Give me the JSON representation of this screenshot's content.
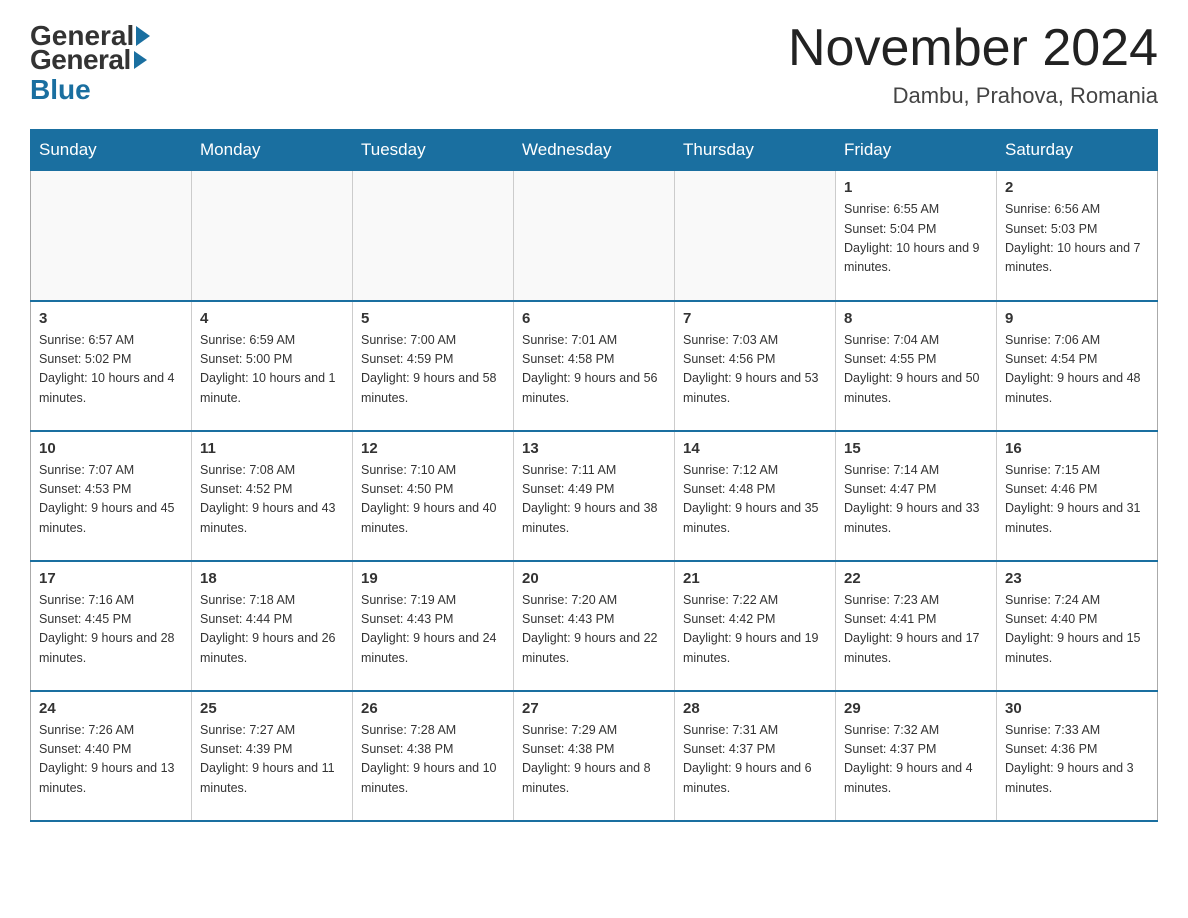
{
  "header": {
    "logo_general": "General",
    "logo_blue": "Blue",
    "title": "November 2024",
    "subtitle": "Dambu, Prahova, Romania"
  },
  "days_of_week": [
    "Sunday",
    "Monday",
    "Tuesday",
    "Wednesday",
    "Thursday",
    "Friday",
    "Saturday"
  ],
  "weeks": [
    [
      {
        "day": "",
        "info": ""
      },
      {
        "day": "",
        "info": ""
      },
      {
        "day": "",
        "info": ""
      },
      {
        "day": "",
        "info": ""
      },
      {
        "day": "",
        "info": ""
      },
      {
        "day": "1",
        "info": "Sunrise: 6:55 AM\nSunset: 5:04 PM\nDaylight: 10 hours and 9 minutes."
      },
      {
        "day": "2",
        "info": "Sunrise: 6:56 AM\nSunset: 5:03 PM\nDaylight: 10 hours and 7 minutes."
      }
    ],
    [
      {
        "day": "3",
        "info": "Sunrise: 6:57 AM\nSunset: 5:02 PM\nDaylight: 10 hours and 4 minutes."
      },
      {
        "day": "4",
        "info": "Sunrise: 6:59 AM\nSunset: 5:00 PM\nDaylight: 10 hours and 1 minute."
      },
      {
        "day": "5",
        "info": "Sunrise: 7:00 AM\nSunset: 4:59 PM\nDaylight: 9 hours and 58 minutes."
      },
      {
        "day": "6",
        "info": "Sunrise: 7:01 AM\nSunset: 4:58 PM\nDaylight: 9 hours and 56 minutes."
      },
      {
        "day": "7",
        "info": "Sunrise: 7:03 AM\nSunset: 4:56 PM\nDaylight: 9 hours and 53 minutes."
      },
      {
        "day": "8",
        "info": "Sunrise: 7:04 AM\nSunset: 4:55 PM\nDaylight: 9 hours and 50 minutes."
      },
      {
        "day": "9",
        "info": "Sunrise: 7:06 AM\nSunset: 4:54 PM\nDaylight: 9 hours and 48 minutes."
      }
    ],
    [
      {
        "day": "10",
        "info": "Sunrise: 7:07 AM\nSunset: 4:53 PM\nDaylight: 9 hours and 45 minutes."
      },
      {
        "day": "11",
        "info": "Sunrise: 7:08 AM\nSunset: 4:52 PM\nDaylight: 9 hours and 43 minutes."
      },
      {
        "day": "12",
        "info": "Sunrise: 7:10 AM\nSunset: 4:50 PM\nDaylight: 9 hours and 40 minutes."
      },
      {
        "day": "13",
        "info": "Sunrise: 7:11 AM\nSunset: 4:49 PM\nDaylight: 9 hours and 38 minutes."
      },
      {
        "day": "14",
        "info": "Sunrise: 7:12 AM\nSunset: 4:48 PM\nDaylight: 9 hours and 35 minutes."
      },
      {
        "day": "15",
        "info": "Sunrise: 7:14 AM\nSunset: 4:47 PM\nDaylight: 9 hours and 33 minutes."
      },
      {
        "day": "16",
        "info": "Sunrise: 7:15 AM\nSunset: 4:46 PM\nDaylight: 9 hours and 31 minutes."
      }
    ],
    [
      {
        "day": "17",
        "info": "Sunrise: 7:16 AM\nSunset: 4:45 PM\nDaylight: 9 hours and 28 minutes."
      },
      {
        "day": "18",
        "info": "Sunrise: 7:18 AM\nSunset: 4:44 PM\nDaylight: 9 hours and 26 minutes."
      },
      {
        "day": "19",
        "info": "Sunrise: 7:19 AM\nSunset: 4:43 PM\nDaylight: 9 hours and 24 minutes."
      },
      {
        "day": "20",
        "info": "Sunrise: 7:20 AM\nSunset: 4:43 PM\nDaylight: 9 hours and 22 minutes."
      },
      {
        "day": "21",
        "info": "Sunrise: 7:22 AM\nSunset: 4:42 PM\nDaylight: 9 hours and 19 minutes."
      },
      {
        "day": "22",
        "info": "Sunrise: 7:23 AM\nSunset: 4:41 PM\nDaylight: 9 hours and 17 minutes."
      },
      {
        "day": "23",
        "info": "Sunrise: 7:24 AM\nSunset: 4:40 PM\nDaylight: 9 hours and 15 minutes."
      }
    ],
    [
      {
        "day": "24",
        "info": "Sunrise: 7:26 AM\nSunset: 4:40 PM\nDaylight: 9 hours and 13 minutes."
      },
      {
        "day": "25",
        "info": "Sunrise: 7:27 AM\nSunset: 4:39 PM\nDaylight: 9 hours and 11 minutes."
      },
      {
        "day": "26",
        "info": "Sunrise: 7:28 AM\nSunset: 4:38 PM\nDaylight: 9 hours and 10 minutes."
      },
      {
        "day": "27",
        "info": "Sunrise: 7:29 AM\nSunset: 4:38 PM\nDaylight: 9 hours and 8 minutes."
      },
      {
        "day": "28",
        "info": "Sunrise: 7:31 AM\nSunset: 4:37 PM\nDaylight: 9 hours and 6 minutes."
      },
      {
        "day": "29",
        "info": "Sunrise: 7:32 AM\nSunset: 4:37 PM\nDaylight: 9 hours and 4 minutes."
      },
      {
        "day": "30",
        "info": "Sunrise: 7:33 AM\nSunset: 4:36 PM\nDaylight: 9 hours and 3 minutes."
      }
    ]
  ]
}
